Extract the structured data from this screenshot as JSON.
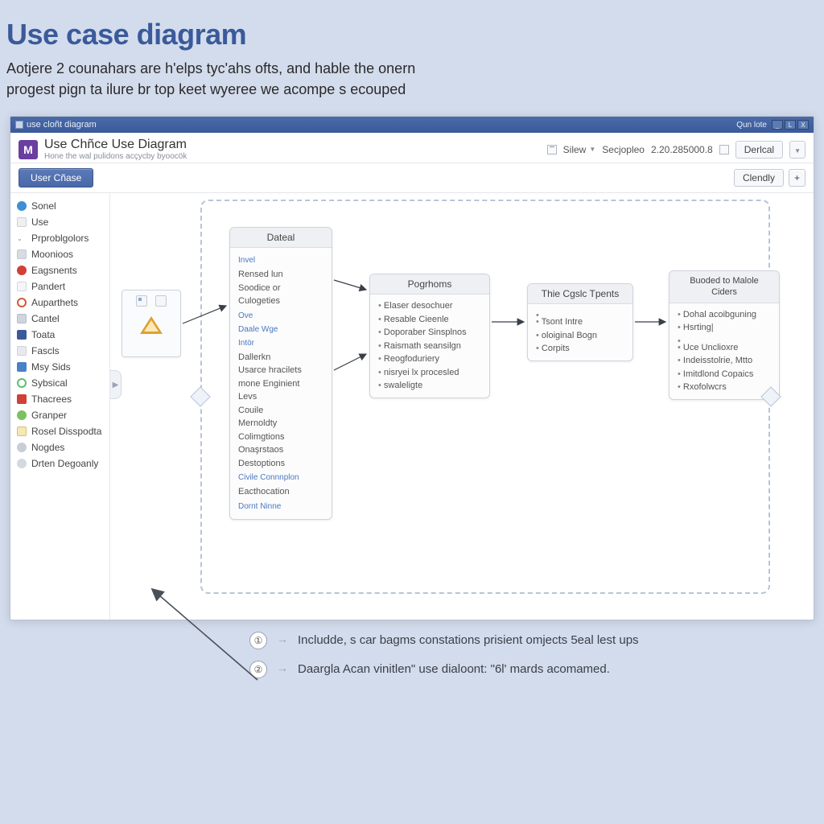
{
  "page": {
    "title": "Use case diagram",
    "desc": "Aotjere 2 counahars are h'elps tyc'ahs ofts, and hable the onern progest pign ta ilure br top keet wyeree we acompe s ecouped"
  },
  "titlebar": {
    "text": "use cloñt diagram",
    "open": "Qun lote",
    "under": "_",
    "max": "L",
    "close": "X"
  },
  "brand": {
    "letter": "M"
  },
  "header": {
    "title": "Use Chñce Use Diagram",
    "sub": "Hone the wal pulidons acçycby byoocök",
    "silew": "Silew",
    "secjo": "Secjopleo",
    "version": "2.20.285000.8",
    "derical": "Derlcal"
  },
  "subbar": {
    "tab": "User Cñase",
    "clandy": "Clendly",
    "plus": "+"
  },
  "sidebar": {
    "items": [
      {
        "label": "Sonel",
        "color": "#3d8fd6",
        "round": true
      },
      {
        "label": "Use",
        "color": "#f0f0f0"
      },
      {
        "label": "Prproblgolors",
        "color": "#e8ecf2",
        "chev": true
      },
      {
        "label": "Moonioos",
        "color": "#d7dbe3"
      },
      {
        "label": "Eagsnents",
        "color": "#d04038",
        "round": true
      },
      {
        "label": "Pandert",
        "color": "#e8ecf2"
      },
      {
        "label": "Auparthets",
        "color": "#d05a3a",
        "round": true
      },
      {
        "label": "Cantel",
        "color": "#9aa6b8"
      },
      {
        "label": "Toata",
        "color": "#3b5998"
      },
      {
        "label": "Fascls",
        "color": "#c8cdd6"
      },
      {
        "label": "Msy Sids",
        "color": "#4a80c8"
      },
      {
        "label": "Sybsical",
        "color": "#5abf6e",
        "round": true
      },
      {
        "label": "Thacrees",
        "color": "#d04038"
      },
      {
        "label": "Granper",
        "color": "#7cc060",
        "round": true
      },
      {
        "label": "Rosel Disspodta",
        "color": "#d8b050"
      },
      {
        "label": "Nogdes",
        "color": "#aab0ba",
        "round": true
      },
      {
        "label": "Drten Degoanly",
        "color": "#9aa0aa",
        "round": true
      }
    ]
  },
  "cards": {
    "c1": {
      "title": "Dateal",
      "lines": [
        {
          "t": "Invel",
          "link": true
        },
        {
          "t": "Rensed lun"
        },
        {
          "t": "Soodice or"
        },
        {
          "t": "Culogeties"
        },
        {
          "t": "Ove",
          "link": true
        },
        {
          "t": "Daale Wge",
          "link": true
        },
        {
          "t": "Intör",
          "link": true
        },
        {
          "t": "Dallerkn"
        },
        {
          "t": "Usarce hracilets"
        },
        {
          "t": "mone Enginient"
        },
        {
          "t": "Levs"
        },
        {
          "t": "Couile"
        },
        {
          "t": "Mernoldty"
        },
        {
          "t": "Colimgtions"
        },
        {
          "t": "Onaşrstaos"
        },
        {
          "t": "Destoptions"
        },
        {
          "t": "Civile Connnplon",
          "link": true
        },
        {
          "t": "Eacthocation"
        },
        {
          "t": "Dornt Ninne",
          "link": true
        }
      ]
    },
    "c2": {
      "title": "Pogrhoms",
      "lines": [
        {
          "t": "Elaser desochuer"
        },
        {
          "t": "Resable Cieenle"
        },
        {
          "t": "Doporaber Sinsplnos"
        },
        {
          "t": "Raismath seansilgn"
        },
        {
          "t": "Reogfoduriery"
        },
        {
          "t": "nisryei lx procesled"
        },
        {
          "t": "swaleligte"
        }
      ]
    },
    "c3": {
      "title": "Thie Cgslc Tpents",
      "lines": [
        {
          "t": "Tsont Intre"
        },
        {
          "t": "oloiginal Bogn"
        },
        {
          "t": "Corpits"
        }
      ]
    },
    "c4": {
      "title": "Buoded to Malole Ciders",
      "lines": [
        {
          "t": "Dohal acoibguning"
        },
        {
          "t": "Hsrting|"
        },
        {
          "t": ""
        },
        {
          "t": "Uce Unclioxre"
        },
        {
          "t": "Indeisstolrie, Mtto"
        },
        {
          "t": "Imitdlond Copaics"
        },
        {
          "t": "Rxofolwcrs"
        }
      ]
    }
  },
  "annot": {
    "n1": "①",
    "n2": "②",
    "t1": "Includde, s car bagms constations prisient omjects 5eal lest ups",
    "t2": "Daargla Acan vinitlen\" use dialoont: \"6l' mards acomamed."
  }
}
